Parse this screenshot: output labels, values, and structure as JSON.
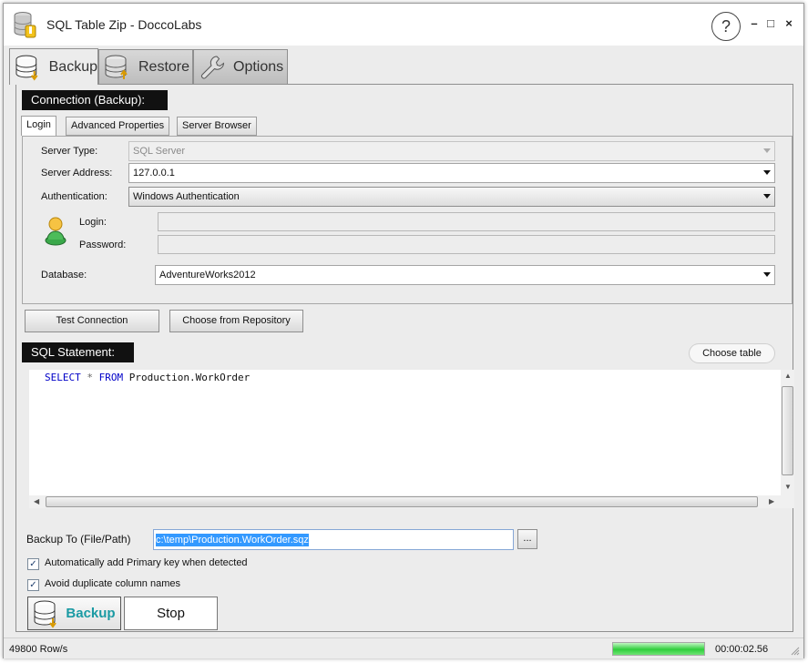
{
  "window": {
    "title": "SQL Table Zip - DoccoLabs",
    "help": "?",
    "minimize": "–",
    "maximize": "□",
    "close": "×"
  },
  "main_tabs": [
    {
      "label": "Backup",
      "icon": "database-download-icon",
      "active": true
    },
    {
      "label": "Restore",
      "icon": "database-upload-icon",
      "active": false
    },
    {
      "label": "Options",
      "icon": "wrench-icon",
      "active": false
    }
  ],
  "connection": {
    "header": "Connection (Backup):",
    "tabs": [
      "Login",
      "Advanced Properties",
      "Server Browser"
    ],
    "server_type_label": "Server Type:",
    "server_type_value": "SQL Server",
    "server_address_label": "Server Address:",
    "server_address_value": "127.0.0.1",
    "authentication_label": "Authentication:",
    "authentication_value": "Windows Authentication",
    "login_label": "Login:",
    "login_value": "",
    "password_label": "Password:",
    "password_value": "",
    "database_label": "Database:",
    "database_value": "AdventureWorks2012"
  },
  "buttons": {
    "test_connection": "Test Connection",
    "choose_repository": "Choose from Repository",
    "choose_table": "Choose table",
    "browse": "...",
    "backup": "Backup",
    "stop": "Stop"
  },
  "sql": {
    "header": "SQL Statement:",
    "kw_select": "SELECT",
    "star": "*",
    "kw_from": "FROM",
    "table": "Production.WorkOrder"
  },
  "backup_to": {
    "label": "Backup To (File/Path)",
    "value": "c:\\temp\\Production.WorkOrder.sqz"
  },
  "options": {
    "auto_pk_label": "Automatically add Primary key when detected",
    "auto_pk_checked": true,
    "avoid_dup_label": "Avoid duplicate column names",
    "avoid_dup_checked": true
  },
  "status": {
    "rate": "49800 Row/s",
    "progress": 1.0,
    "elapsed": "00:00:02.56"
  },
  "colors": {
    "accent": "#1a9aa3",
    "header_bg": "#111111",
    "progress_green": "#2fce3c",
    "selection": "#3399ff"
  }
}
